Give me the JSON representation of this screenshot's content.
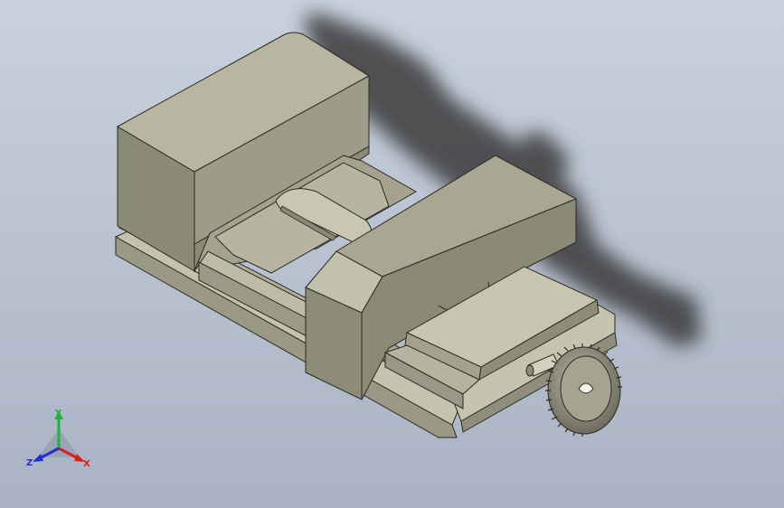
{
  "viewport": {
    "model": "machine-vise",
    "background_top": "#c9d1de",
    "background_bottom": "#a9b3c3"
  },
  "triad": {
    "x_label": "X",
    "y_label": "Y",
    "z_label": "Z",
    "x_color": "#d92020",
    "y_color": "#23b040",
    "z_color": "#2030d0"
  }
}
